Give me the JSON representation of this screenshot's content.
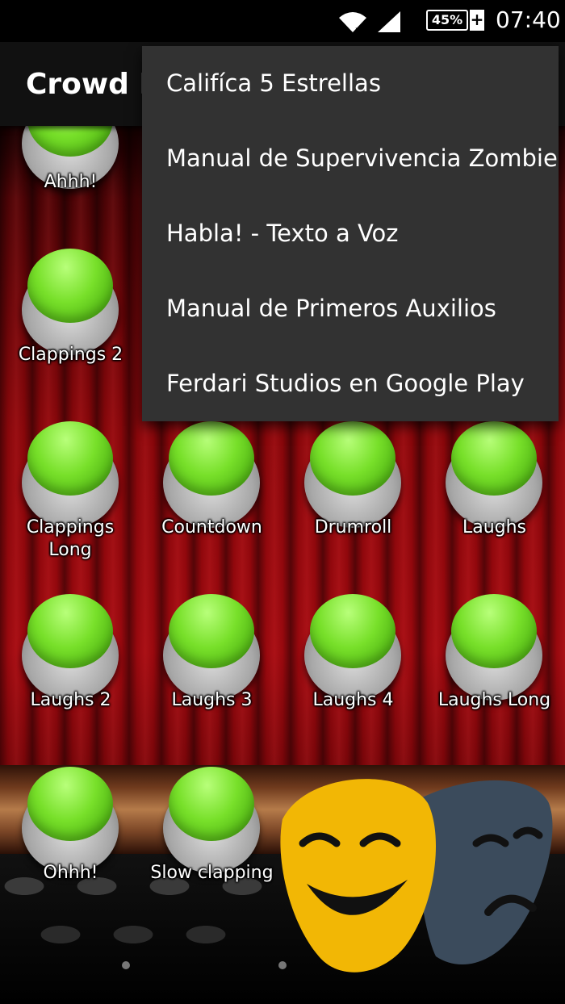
{
  "status_bar": {
    "battery": "45%",
    "battery_charging": "+",
    "time": "07:40"
  },
  "app_bar": {
    "title": "Crowd R"
  },
  "buttons": [
    {
      "label": "Ahhh!"
    },
    {
      "label": "Clappings 2"
    },
    {
      "label": "Clappings Long"
    },
    {
      "label": "Countdown"
    },
    {
      "label": "Drumroll"
    },
    {
      "label": "Laughs"
    },
    {
      "label": "Laughs 2"
    },
    {
      "label": "Laughs 3"
    },
    {
      "label": "Laughs 4"
    },
    {
      "label": "Laughs Long"
    },
    {
      "label": "Ohhh!"
    },
    {
      "label": "Slow clapping"
    }
  ],
  "menu": {
    "items": [
      "Califíca 5 Estrellas",
      "Manual de Supervivencia Zombie",
      "Habla! - Texto a Voz",
      "Manual de Primeros Auxilios",
      "Ferdari Studios en Google Play"
    ]
  },
  "icons": {
    "wifi": "wifi-icon",
    "signal": "signal-icon",
    "battery": "battery-icon",
    "masks": "theater-masks-icon"
  },
  "colors": {
    "curtain_red": "#a1090f",
    "button_green": "#78e02a",
    "menu_bg": "#323232",
    "mask_comedy": "#f2b705",
    "mask_tragedy": "#3b4b5c"
  }
}
